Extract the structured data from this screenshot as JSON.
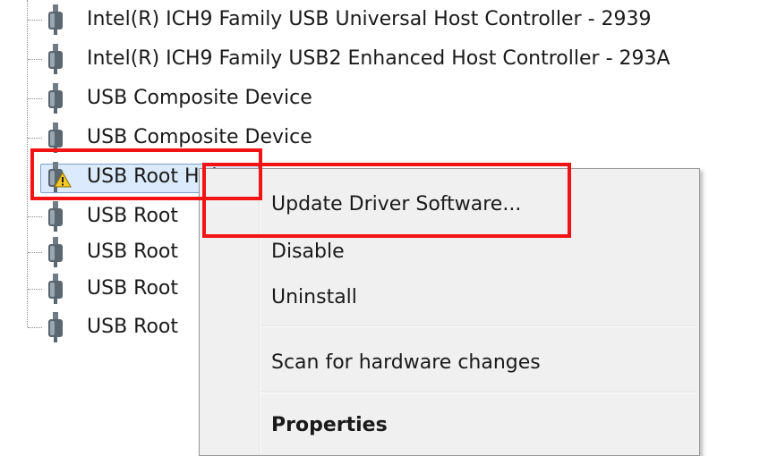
{
  "tree": {
    "items": [
      {
        "label": "Intel(R) ICH9 Family USB Universal Host Controller - 2939",
        "icon": "usb-plug-icon"
      },
      {
        "label": "Intel(R) ICH9 Family USB2 Enhanced Host Controller - 293A",
        "icon": "usb-plug-icon"
      },
      {
        "label": "USB Composite Device",
        "icon": "usb-plug-icon"
      },
      {
        "label": "USB Composite Device",
        "icon": "usb-plug-icon"
      },
      {
        "label": "USB Root Hub",
        "icon": "usb-plug-icon",
        "status_icon": "warning-icon",
        "selected": true
      },
      {
        "label": "USB Root",
        "icon": "usb-plug-icon"
      },
      {
        "label": "USB Root",
        "icon": "usb-plug-icon"
      },
      {
        "label": "USB Root",
        "icon": "usb-plug-icon"
      },
      {
        "label": "USB Root",
        "icon": "usb-plug-icon"
      }
    ]
  },
  "context_menu": {
    "items": [
      {
        "label": "Update Driver Software..."
      },
      {
        "label": "Disable"
      },
      {
        "label": "Uninstall"
      },
      {
        "label": "Scan for hardware changes"
      },
      {
        "label": "Properties",
        "bold": true
      }
    ]
  },
  "colors": {
    "highlight": "#f21414",
    "selection_fill": "#dbeafc",
    "selection_border": "#7da2ce",
    "menu_bg": "#f0f0f0",
    "warning": "#f6c925"
  }
}
